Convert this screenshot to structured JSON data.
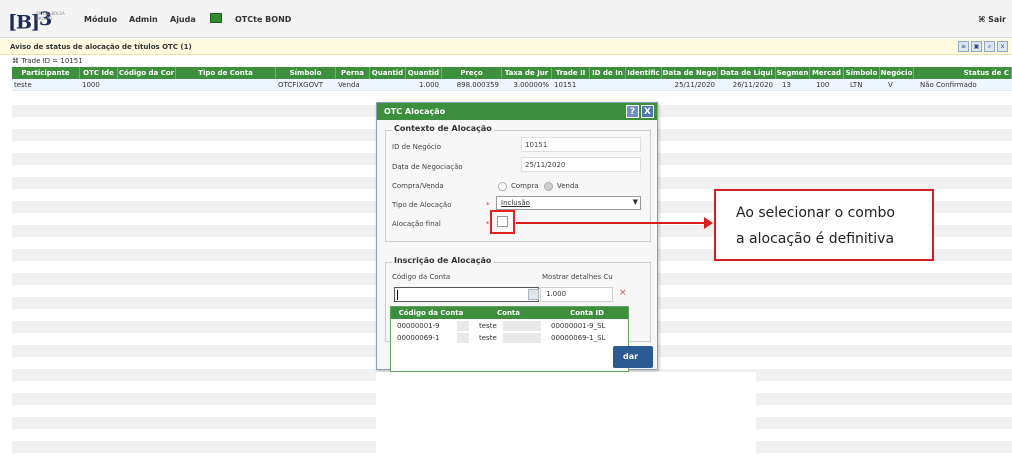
{
  "topbar": {
    "logo_mark": "[B]",
    "logo_sup": "3",
    "logo_sub": "BRASIL BOLSA BALCÃO",
    "menu": [
      "Módulo",
      "Admin",
      "Ajuda",
      "OTCte BOND"
    ],
    "logout": "⌘ Sair"
  },
  "page": {
    "title": "Aviso de status de alocação de títulos OTC  (1)",
    "filter": "⌘ Trade ID = 10151",
    "toolbar_icons": [
      "export-icon",
      "print-icon",
      "search-icon",
      "excel-icon"
    ]
  },
  "grid": {
    "columns": [
      "Participante",
      "OTC Ide",
      "Código da Cor",
      "Tipo de Conta",
      "Símbolo",
      "Perna",
      "Quantid",
      "Quantid",
      "Preço",
      "Taxa de Jur",
      "Trade II",
      "ID de In",
      "Identific",
      "Data de Nego",
      "Data de Liqui",
      "Segmen",
      "Mercad",
      "Símbolo",
      "Negócio",
      "Status de C"
    ],
    "rows": [
      [
        "teste",
        "1000",
        "",
        "",
        "OTCFIXGOVT",
        "Venda",
        "",
        "1.000",
        "898.000359",
        "3.00000%",
        "10151",
        "",
        "",
        "25/11/2020",
        "26/11/2020",
        "13",
        "100",
        "LTN",
        "V",
        "Não Confirmado"
      ]
    ]
  },
  "dialog": {
    "title": "OTC Alocação",
    "help": "?",
    "close": "X",
    "context": {
      "legend": "Contexto de Alocação",
      "trade_id_label": "ID de Negócio",
      "trade_id_value": "10151",
      "trade_date_label": "Data de Negociação",
      "trade_date_value": "25/11/2020",
      "side_label": "Compra/Venda",
      "side_buy": "Compra",
      "side_sell": "Venda",
      "side_selected": "Venda",
      "alloc_type_label": "Tipo de Alocação",
      "alloc_type_value": "Inclusão",
      "final_label": "Alocação final",
      "required_mark": "*",
      "final_checked": false
    },
    "inscription": {
      "legend": "Inscrição de Alocação",
      "account_label": "Código da Conta",
      "account_value": "",
      "details_label": "Mostrar detalhes Cu",
      "quantity_value": "1.000",
      "clear": "×",
      "dropdown_headers": [
        "Código da Conta",
        "Conta",
        "Conta ID"
      ],
      "dropdown_rows": [
        [
          "00000001-9",
          "teste",
          "00000001-9_SL"
        ],
        [
          "00000069-1",
          "teste",
          "00000069-1_SL"
        ]
      ],
      "partial_button": "dar"
    }
  },
  "annotation": {
    "line1": "Ao selecionar o combo",
    "line2": "a alocação é definitiva",
    "color": "#d61e1e"
  }
}
